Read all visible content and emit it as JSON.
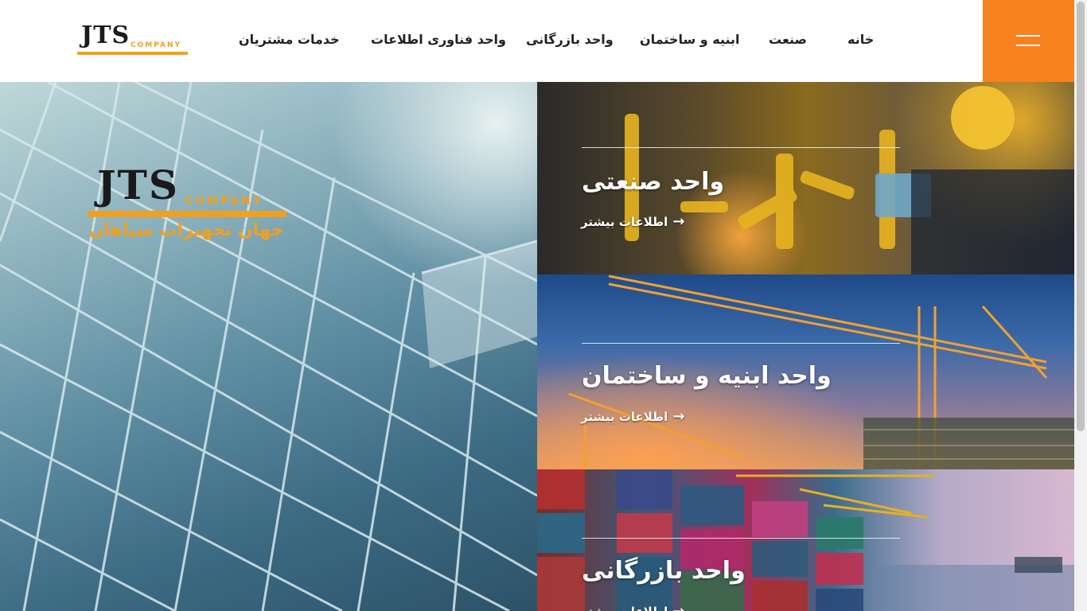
{
  "header": {
    "logo_mark": "JTS",
    "logo_sub": "COMPANY",
    "nav": [
      {
        "label": "خانه"
      },
      {
        "label": "صنعت"
      },
      {
        "label": "ابنیه و ساختمان"
      },
      {
        "label": "واحد بازرگانی"
      },
      {
        "label": "واحد فناوری اطلاعات"
      },
      {
        "label": "خدمات مشتریان"
      }
    ]
  },
  "hero": {
    "logo_mark": "JTS",
    "logo_sub": "COMPANY",
    "tagline": "جهان تجهیزات سپاهان"
  },
  "tiles": [
    {
      "title": "واحد صنعتی",
      "more": "اطلاعات بیشتر"
    },
    {
      "title": "واحد ابنیه و ساختمان",
      "more": "اطلاعات بیشتر"
    },
    {
      "title": "واحد بازرگانی",
      "more": "اطلاعات بیشتر"
    }
  ],
  "icons": {
    "menu": "hamburger-menu-icon",
    "arrow": "arrow-left-icon"
  },
  "colors": {
    "accent": "#f7821e",
    "logo_yellow": "#f0a020"
  }
}
